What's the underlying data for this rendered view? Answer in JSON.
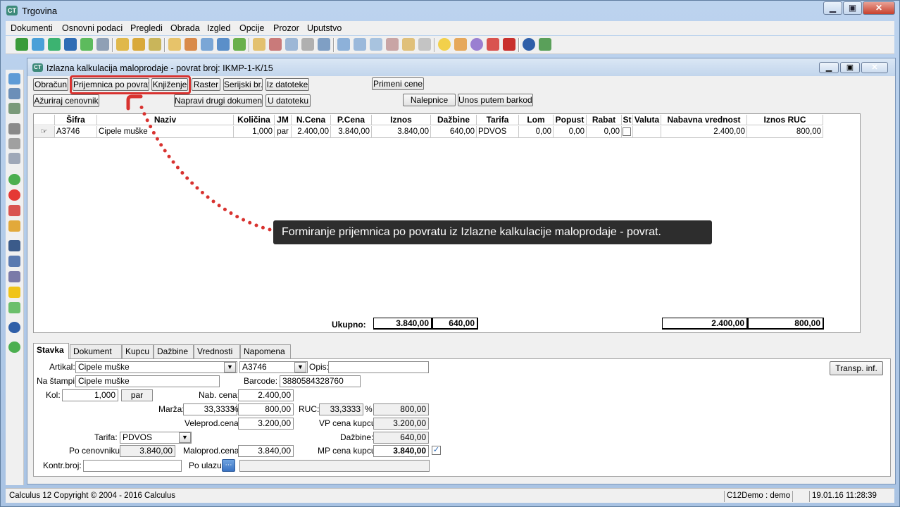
{
  "app": {
    "title": "Trgovina",
    "icon_text": "CT"
  },
  "window_buttons": {
    "minimize": "▁",
    "maximize": "▣",
    "close": "✕"
  },
  "menu": [
    "Dokumenti",
    "Osnovni podaci",
    "Pregledi",
    "Obrada",
    "Izgled",
    "Opcije",
    "Prozor",
    "Uputstvo"
  ],
  "child": {
    "title": "Izlazna kalkulacija maloprodaje - povrat broj: IKMP-1-K/15",
    "icon_text": "CT"
  },
  "buttons": {
    "obracun": "Obračun",
    "prijemnica": "Prijemnica po povratu",
    "knjizenje": "Knjiženje",
    "raster": "Raster",
    "serijski": "Serijski br.",
    "iz_datoteke": "Iz datoteke",
    "primeni_cene": "Primeni cene",
    "azuriraj": "Ažuriraj cenovnik",
    "napravi": "Napravi drugi dokument",
    "u_datoteku": "U datoteku",
    "nalepnice": "Nalepnice",
    "barkod": "Unos putem barkoda",
    "transp": "Transp. inf."
  },
  "grid": {
    "headers": [
      "Šifra",
      "Naziv",
      "Količina",
      "JM",
      "N.Cena",
      "P.Cena",
      "Iznos",
      "Dažbine",
      "Tarifa",
      "Lom",
      "Popust",
      "Rabat",
      "St",
      "Valuta",
      "Nabavna vrednost",
      "Iznos RUC"
    ],
    "row": [
      "A3746",
      "Cipele muške",
      "1,000",
      "par",
      "2.400,00",
      "3.840,00",
      "3.840,00",
      "640,00",
      "PDVOS",
      "0,00",
      "0,00",
      "0,00",
      "",
      "",
      "2.400,00",
      "800,00"
    ]
  },
  "totals": {
    "label": "Ukupno:",
    "iznos": "3.840,00",
    "dazbine": "640,00",
    "nabavna": "2.400,00",
    "ruc": "800,00"
  },
  "callout": "Formiranje prijemnica po povratu iz Izlazne kalkulacije maloprodaje - povrat.",
  "tabs": [
    "Stavka",
    "Dokument",
    "Kupcu",
    "Dažbine",
    "Vrednosti",
    "Napomena"
  ],
  "form": {
    "artikal_label": "Artikal:",
    "artikal": "Cipele muške",
    "sifra": "A3746",
    "opis_label": "Opis:",
    "opis": "",
    "na_stampi_label": "Na štampi:",
    "na_stampi": "Cipele muške",
    "barcode_label": "Barcode:",
    "barcode": "3880584328760",
    "kol_label": "Kol:",
    "kol": "1,000",
    "jm": "par",
    "nab_cena_label": "Nab. cena:",
    "nab_cena": "2.400,00",
    "marza_label": "Marža:",
    "marza_pct": "33,3333",
    "pct": "%",
    "marza_iznos": "800,00",
    "ruc_label": "RUC:",
    "ruc_pct": "33,3333",
    "ruc_iznos": "800,00",
    "veleprod_label": "Veleprod.cena:",
    "veleprod": "3.200,00",
    "vp_kupcu_label": "VP cena kupcu:",
    "vp_kupcu": "3.200,00",
    "tarifa_label": "Tarifa:",
    "tarifa": "PDVOS",
    "dazbine_label": "Dažbine:",
    "dazbine": "640,00",
    "po_cenovniku_label": "Po cenovniku:",
    "po_cenovniku": "3.840,00",
    "maloprod_label": "Maloprod.cena:",
    "maloprod": "3.840,00",
    "mp_kupcu_label": "MP cena kupcu:",
    "mp_kupcu": "3.840,00",
    "kontr_label": "Kontr.broj:",
    "kontr": "",
    "po_ulazu_label": "Po ulazu:",
    "po_ulazu": ""
  },
  "status": {
    "copyright": "Calculus 12  Copyright © 2004 - 2016  Calculus",
    "user": "C12Demo : demo",
    "datetime": "19.01.16 11:28:39"
  },
  "colors": {
    "accent_red": "#d8322f",
    "callout_bg": "#2d2d2d",
    "title_bg": "#bcd3ee"
  }
}
